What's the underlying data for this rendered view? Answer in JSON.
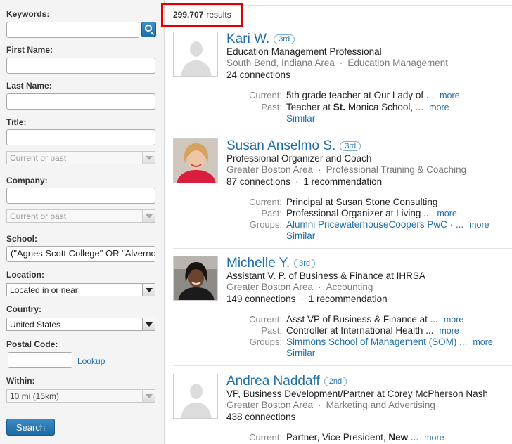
{
  "sidebar": {
    "keywords": {
      "label": "Keywords:",
      "value": ""
    },
    "first_name": {
      "label": "First Name:",
      "value": ""
    },
    "last_name": {
      "label": "Last Name:",
      "value": ""
    },
    "title": {
      "label": "Title:",
      "value": "",
      "scope": "Current or past"
    },
    "company": {
      "label": "Company:",
      "value": "",
      "scope": "Current or past"
    },
    "school": {
      "label": "School:",
      "value": "(\"Agnes Scott College\" OR \"Alverno College\""
    },
    "location": {
      "label": "Location:",
      "selected": "Located in or near:"
    },
    "country": {
      "label": "Country:",
      "selected": "United States"
    },
    "postal_code": {
      "label": "Postal Code:",
      "value": "",
      "lookup": "Lookup"
    },
    "within": {
      "label": "Within:",
      "selected": "10 mi (15km)"
    },
    "search_button": "Search"
  },
  "results_header": {
    "count": "299,707",
    "suffix": "results"
  },
  "results": [
    {
      "name": "Kari W.",
      "degree": "3rd",
      "photo": "placeholder",
      "headline": "Education Management Professional",
      "location": "South Bend, Indiana Area",
      "industry": "Education Management",
      "connections": "24 connections",
      "details": [
        {
          "label": "Current:",
          "value": "5th grade teacher at Our Lady of ...",
          "more": "more"
        },
        {
          "label": "Past:",
          "value_pre": "Teacher at ",
          "value_bold": "St.",
          "value_post": " Monica School, ...",
          "more": "more"
        }
      ],
      "similar": "Similar"
    },
    {
      "name": "Susan Anselmo S.",
      "degree": "3rd",
      "photo": "woman-red",
      "headline": "Professional Organizer and Coach",
      "location": "Greater Boston Area",
      "industry": "Professional Training & Coaching",
      "connections": "87 connections",
      "recommendations": "1 recommendation",
      "details": [
        {
          "label": "Current:",
          "value": "Principal at Susan Stone Consulting"
        },
        {
          "label": "Past:",
          "value": "Professional Organizer at Living ...",
          "more": "more"
        },
        {
          "label": "Groups:",
          "value": "Alumni PricewaterhouseCoopers PwC · ...",
          "more": "more",
          "link": true
        }
      ],
      "similar": "Similar"
    },
    {
      "name": "Michelle Y.",
      "degree": "3rd",
      "photo": "woman-dark",
      "headline": "Assistant V. P. of Business & Finance at IHRSA",
      "location": "Greater Boston Area",
      "industry": "Accounting",
      "connections": "149 connections",
      "recommendations": "1 recommendation",
      "details": [
        {
          "label": "Current:",
          "value": "Asst VP of Business & Finance at ...",
          "more": "more"
        },
        {
          "label": "Past:",
          "value": "Controller at International Health ...",
          "more": "more"
        },
        {
          "label": "Groups:",
          "value": "Simmons School of Management (SOM) ...",
          "more": "more",
          "link": true
        }
      ],
      "similar": "Similar"
    },
    {
      "name": "Andrea Naddaff",
      "degree": "2nd",
      "photo": "placeholder",
      "headline": "VP, Business Development/Partner at Corey McPherson Nash",
      "location": "Greater Boston Area",
      "industry": "Marketing and Advertising",
      "connections": "438 connections",
      "details": [
        {
          "label": "Current:",
          "value_pre": "Partner, Vice President, ",
          "value_bold": "New",
          "value_post": " ...",
          "more": "more"
        }
      ]
    }
  ]
}
